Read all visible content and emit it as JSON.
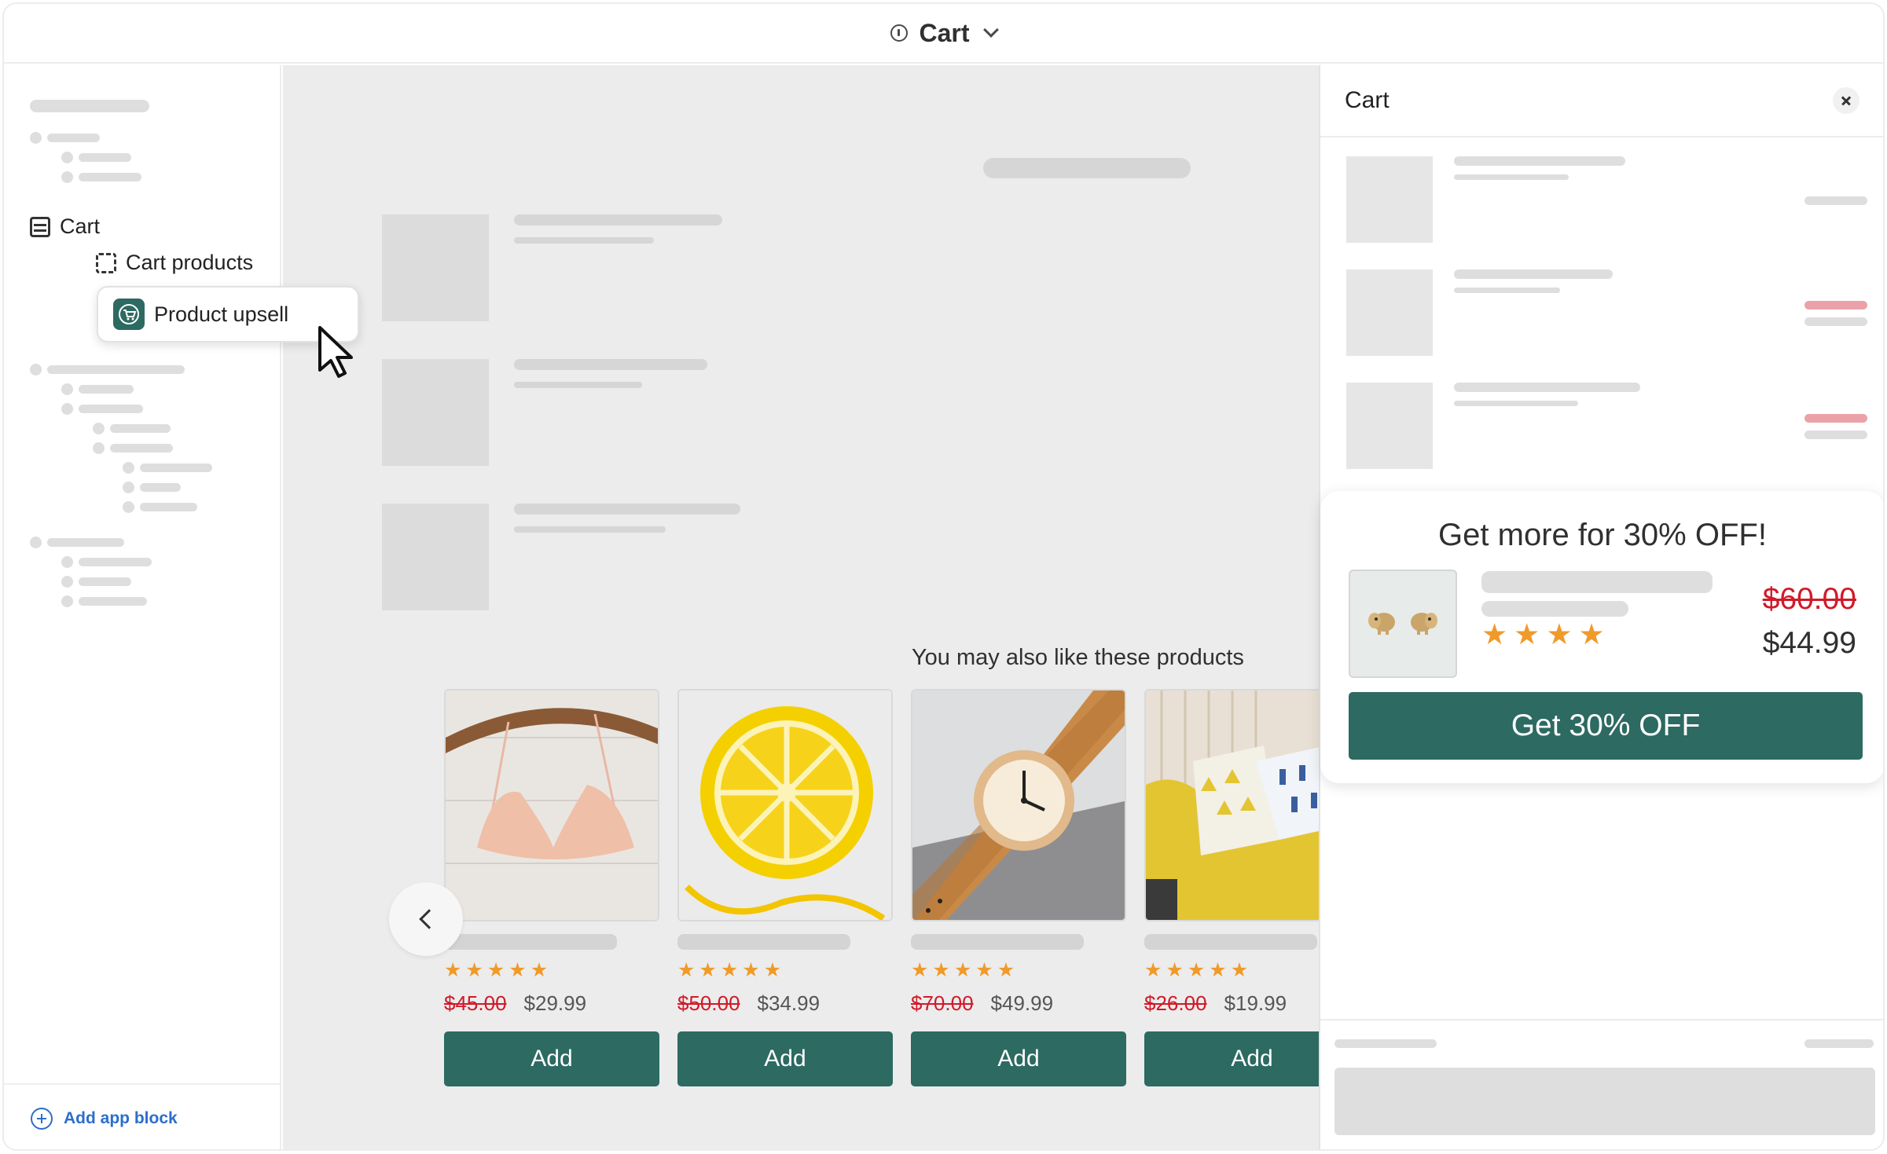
{
  "topbar": {
    "title": "Cart"
  },
  "sidebar": {
    "section_label": "Cart",
    "block_label": "Cart products",
    "app_block_label": "Product upsell",
    "add_app_block": "Add app block"
  },
  "recommendations": {
    "title": "You may also like these products",
    "products": [
      {
        "old_price": "$45.00",
        "price": "$29.99",
        "rating": 5,
        "add_label": "Add"
      },
      {
        "old_price": "$50.00",
        "price": "$34.99",
        "rating": 5,
        "add_label": "Add"
      },
      {
        "old_price": "$70.00",
        "price": "$49.99",
        "rating": 5,
        "add_label": "Add"
      },
      {
        "old_price": "$26.00",
        "price": "$19.99",
        "rating": 5,
        "add_label": "Add"
      }
    ]
  },
  "drawer": {
    "title": "Cart",
    "upsell": {
      "heading": "Get more for 30% OFF!",
      "old_price": "$60.00",
      "price": "$44.99",
      "rating": 4,
      "button_label": "Get 30% OFF"
    }
  },
  "colors": {
    "accent": "#2c6a62",
    "sale": "#d11a2a",
    "star": "#f09a2a",
    "link": "#2c6ecb"
  },
  "icons": [
    "info-icon",
    "chevron-down-icon",
    "section-icon",
    "block-icon",
    "cart-app-icon",
    "pointer-cursor-icon",
    "plus-circle-icon",
    "chevron-left-icon",
    "close-icon",
    "star-icon"
  ]
}
